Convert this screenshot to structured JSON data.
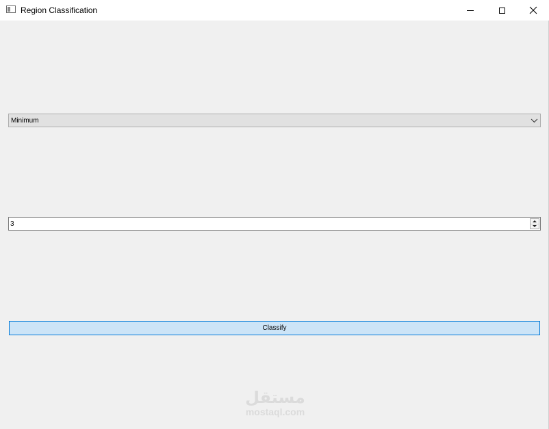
{
  "window": {
    "title": "Region Classification",
    "controls": {
      "minimize_icon": "minimize-icon",
      "maximize_icon": "maximize-icon",
      "close_icon": "close-icon"
    }
  },
  "form": {
    "method_select": {
      "selected": "Minimum"
    },
    "number_spinbox": {
      "value": "3"
    },
    "classify_button": {
      "label": "Classify"
    }
  },
  "watermark": {
    "logo_text": "مستقل",
    "domain": "mostaql.com"
  },
  "colors": {
    "window_bg": "#f0f0f0",
    "titlebar_bg": "#ffffff",
    "button_bg": "#cce4f7",
    "button_border": "#0078d7",
    "watermark": "#dadada"
  }
}
